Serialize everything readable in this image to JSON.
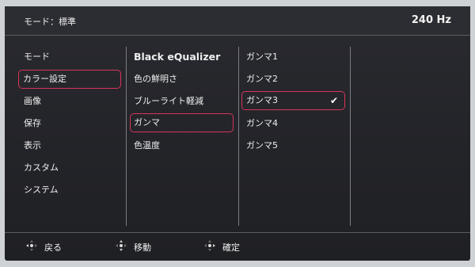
{
  "header": {
    "mode_label": "モード：標準",
    "refresh_rate": "240 Hz"
  },
  "menu": {
    "main_items": [
      "モード",
      "カラー設定",
      "画像",
      "保存",
      "表示",
      "カスタム",
      "システム"
    ],
    "main_selected": "カラー設定",
    "color_items": [
      "Black eQualizer",
      "色の鮮明さ",
      "ブルーライト軽減",
      "ガンマ",
      "色温度"
    ],
    "color_selected": "ガンマ",
    "gamma_items": [
      "ガンマ1",
      "ガンマ2",
      "ガンマ3",
      "ガンマ4",
      "ガンマ5"
    ],
    "gamma_selected": "ガンマ3",
    "check_mark": "✔"
  },
  "footer": {
    "back_label": "戻る",
    "move_label": "移動",
    "confirm_label": "確定"
  },
  "colors": {
    "highlight_border": "#d7345a",
    "panel_bg": "#24252a"
  }
}
